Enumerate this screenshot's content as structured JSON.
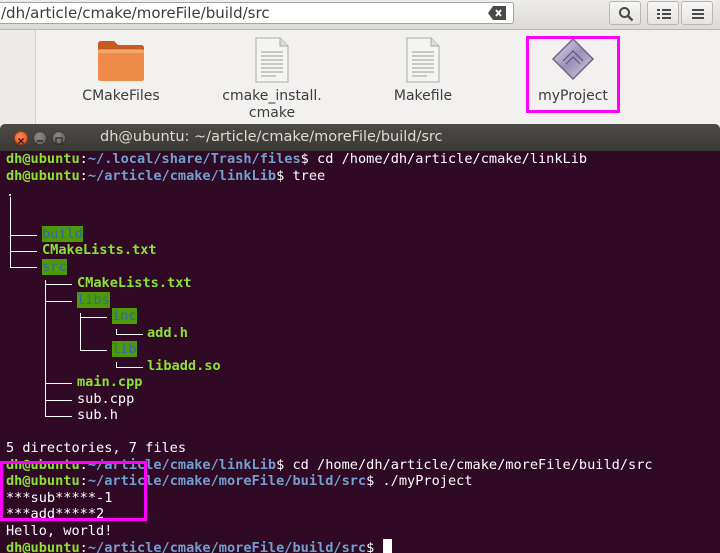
{
  "file_manager": {
    "location": "/dh/article/cmake/moreFile/build/src",
    "items": [
      {
        "label_lines": [
          "CMakeFiles"
        ]
      },
      {
        "label_lines": [
          "cmake_install.",
          "cmake"
        ]
      },
      {
        "label_lines": [
          "Makefile"
        ]
      },
      {
        "label_lines": [
          "myProject"
        ]
      }
    ],
    "icons": {
      "folder": "folder-icon",
      "document": "text-document-icon",
      "executable": "executable-icon",
      "search": "search-icon",
      "list_view": "list-view-icon",
      "menu": "menu-icon",
      "clear": "clear-text-icon"
    }
  },
  "terminal": {
    "title": "dh@ubuntu: ~/article/cmake/moreFile/build/src",
    "lines": {
      "l1": {
        "user": "dh@ubuntu",
        "colon": ":",
        "path": "~/.local/share/Trash/files",
        "dollar": "$ ",
        "cmd": "cd /home/dh/article/cmake/linkLib"
      },
      "l2": {
        "user": "dh@ubuntu",
        "colon": ":",
        "path": "~/article/cmake/linkLib",
        "dollar": "$ ",
        "cmd": "tree"
      },
      "l3": {
        "text": "."
      },
      "l4": {
        "name": "build"
      },
      "l5": {
        "name": "CMakeLists.txt"
      },
      "l6": {
        "name": "src"
      },
      "l7": {
        "name": "CMakeLists.txt"
      },
      "l8": {
        "name": "libs"
      },
      "l9": {
        "name": "inc"
      },
      "l10": {
        "name": "add.h"
      },
      "l11": {
        "name": "lib"
      },
      "l12": {
        "name": "libadd.so"
      },
      "l13": {
        "name": "main.cpp"
      },
      "l14": {
        "name": "sub.cpp"
      },
      "l15": {
        "name": "sub.h"
      },
      "l16": {
        "text": "5 directories, 7 files"
      },
      "l17": {
        "user": "dh@ubuntu",
        "colon": ":",
        "path": "~/article/cmake/linkLib",
        "dollar": "$ ",
        "cmd": "cd /home/dh/article/cmake/moreFile/build/src"
      },
      "l18": {
        "user": "dh@ubuntu",
        "colon": ":",
        "path": "~/article/cmake/moreFile/build/src",
        "dollar": "$ ",
        "cmd": "./myProject"
      },
      "l19": {
        "text": "***sub*****-1"
      },
      "l20": {
        "text": "***add*****2"
      },
      "l21": {
        "text": "Hello, world!"
      },
      "l22": {
        "user": "dh@ubuntu",
        "colon": ":",
        "path": "~/article/cmake/moreFile/build/src",
        "dollar": "$ "
      }
    }
  },
  "colors": {
    "terminal_bg": "#300a24",
    "prompt_user": "#8ae234",
    "prompt_path": "#729fcf",
    "highlight": "#ff00ff"
  }
}
